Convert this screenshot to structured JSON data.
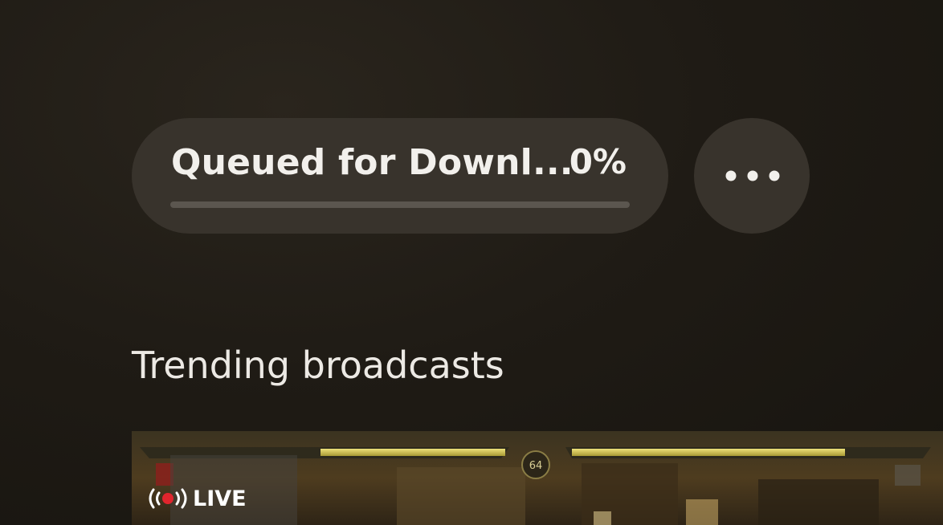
{
  "download": {
    "title": "Queued for Downl...",
    "percent_label": "0%",
    "progress": 0
  },
  "more_button": {
    "icon": "more-options-icon"
  },
  "trending": {
    "heading": "Trending broadcasts",
    "broadcast": {
      "live_label": "LIVE",
      "live_icon": "broadcast-icon"
    }
  },
  "colors": {
    "background": "#1b1813",
    "pill": "#38332c",
    "text": "#f2f0ec",
    "progress_track": "#5b564f",
    "live_dot": "#e0252d"
  }
}
